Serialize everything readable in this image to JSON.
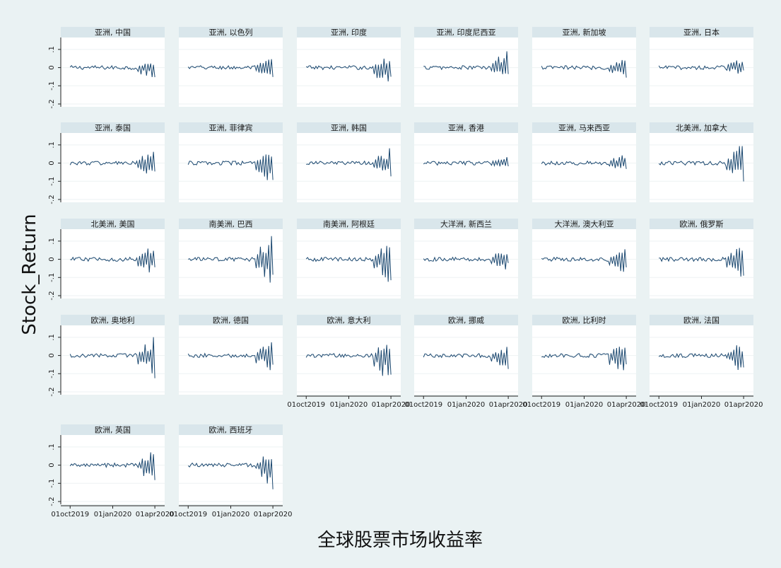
{
  "chart_data": {
    "type": "line",
    "title": "",
    "xlabel": "全球股票市场收益率",
    "ylabel": "Stock_Return",
    "x_range": [
      "2019-09-23",
      "2020-04-10"
    ],
    "ylim": [
      -0.2,
      0.15
    ],
    "yticks": [
      0.1,
      0,
      -0.1,
      -0.2
    ],
    "ytick_labels": [
      ".1",
      "0",
      "-.1",
      "-.2"
    ],
    "xticks": [
      "2019-10-01",
      "2020-01-01",
      "2020-04-01"
    ],
    "xtick_labels": [
      "01oct2019",
      "01jan2020",
      "01apr2020"
    ],
    "grid": true,
    "line_color": "#1a476f",
    "panel_header_color": "#d9e6eb",
    "panels": [
      {
        "title": "亚洲, 中国",
        "ylim_est": [
          -0.08,
          0.04
        ]
      },
      {
        "title": "亚洲, 以色列",
        "ylim_est": [
          -0.06,
          0.06
        ]
      },
      {
        "title": "亚洲, 印度",
        "ylim_est": [
          -0.13,
          0.07
        ]
      },
      {
        "title": "亚洲, 印度尼西亚",
        "ylim_est": [
          -0.06,
          0.1
        ]
      },
      {
        "title": "亚洲, 新加坡",
        "ylim_est": [
          -0.07,
          0.06
        ]
      },
      {
        "title": "亚洲, 日本",
        "ylim_est": [
          -0.05,
          0.08
        ]
      },
      {
        "title": "亚洲, 泰国",
        "ylim_est": [
          -0.09,
          0.08
        ]
      },
      {
        "title": "亚洲, 菲律宾",
        "ylim_est": [
          -0.13,
          0.07
        ]
      },
      {
        "title": "亚洲, 韩国",
        "ylim_est": [
          -0.08,
          0.09
        ]
      },
      {
        "title": "亚洲, 香港",
        "ylim_est": [
          -0.04,
          0.05
        ]
      },
      {
        "title": "亚洲, 马来西亚",
        "ylim_est": [
          -0.05,
          0.07
        ]
      },
      {
        "title": "北美洲, 加拿大",
        "ylim_est": [
          -0.12,
          0.12
        ]
      },
      {
        "title": "北美洲, 美国",
        "ylim_est": [
          -0.12,
          0.09
        ]
      },
      {
        "title": "南美洲, 巴西",
        "ylim_est": [
          -0.15,
          0.14
        ]
      },
      {
        "title": "南美洲, 阿根廷",
        "ylim_est": [
          -0.15,
          0.1
        ]
      },
      {
        "title": "大洋洲, 新西兰",
        "ylim_est": [
          -0.07,
          0.07
        ]
      },
      {
        "title": "大洋洲, 澳大利亚",
        "ylim_est": [
          -0.09,
          0.07
        ]
      },
      {
        "title": "欧洲, 俄罗斯",
        "ylim_est": [
          -0.13,
          0.09
        ]
      },
      {
        "title": "欧洲, 奥地利",
        "ylim_est": [
          -0.14,
          0.11
        ]
      },
      {
        "title": "欧洲, 德国",
        "ylim_est": [
          -0.12,
          0.11
        ]
      },
      {
        "title": "欧洲, 意大利",
        "ylim_est": [
          -0.17,
          0.09
        ]
      },
      {
        "title": "欧洲, 挪威",
        "ylim_est": [
          -0.09,
          0.06
        ]
      },
      {
        "title": "欧洲, 比利时",
        "ylim_est": [
          -0.14,
          0.08
        ]
      },
      {
        "title": "欧洲, 法国",
        "ylim_est": [
          -0.12,
          0.08
        ]
      },
      {
        "title": "欧洲, 英国",
        "ylim_est": [
          -0.11,
          0.09
        ]
      },
      {
        "title": "欧洲, 西班牙",
        "ylim_est": [
          -0.14,
          0.08
        ]
      }
    ]
  }
}
